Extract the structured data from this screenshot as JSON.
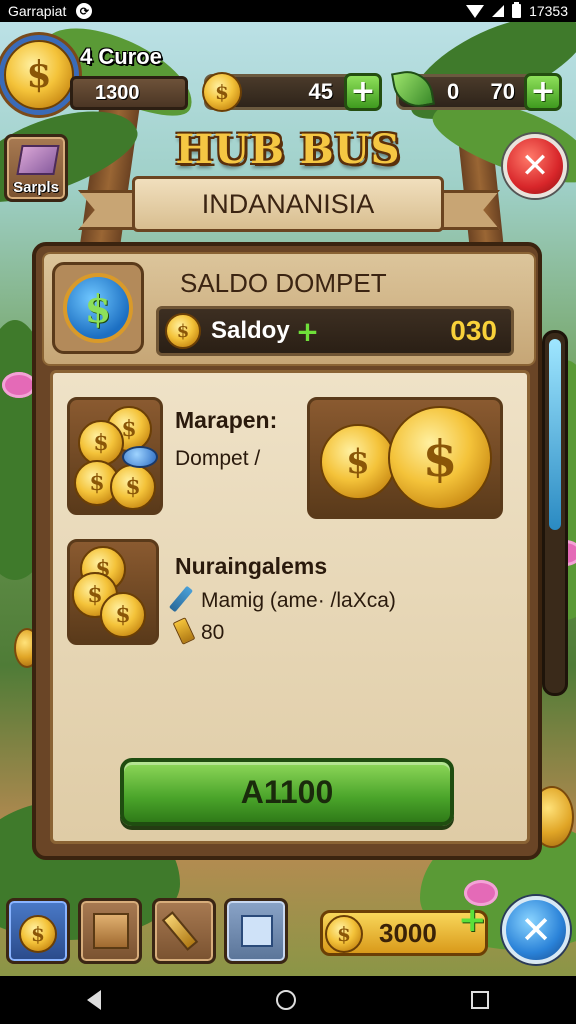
{
  "status_bar": {
    "carrier": "Garrapiat",
    "sync_glyph": "⟳",
    "time": "17353"
  },
  "hud": {
    "profile": {
      "title": "4 Curoe",
      "value": "1300",
      "coin_symbol": "$"
    },
    "coins": {
      "value": "45",
      "coin_symbol": "$",
      "plus": "+"
    },
    "leaves": {
      "value_left": "0",
      "value_right": "70",
      "plus": "+"
    },
    "left_tile": {
      "label": "Sarpls",
      "icon": "gem-icon"
    },
    "close": "✕"
  },
  "title": {
    "main": "HUB BUS",
    "ribbon": "INDANANISIA"
  },
  "panel": {
    "header_title": "SALDO DOMPET",
    "medal_symbol": "$",
    "saldo": {
      "label": "Saldoy",
      "plus": "+",
      "value": "030",
      "coin_symbol": "$"
    },
    "items": [
      {
        "title": "Marapen:",
        "subtitle": "Dompet /",
        "icon": "coin-stack-icon"
      },
      {
        "title": "Nuraingalems",
        "line1": "Mamig (ame· /laXca)",
        "line2": "80",
        "icon": "coin-stack-icon"
      }
    ],
    "scroll_progress": 0.55,
    "primary_button": "A1100"
  },
  "bottom_bar": {
    "tiles": [
      "coin-shop-icon",
      "crate-icon",
      "hammer-icon",
      "map-icon"
    ],
    "gold_value": "3000",
    "coin_symbol": "$",
    "plus": "+",
    "close": "✕"
  },
  "colors": {
    "title_gold": "#f5c743",
    "accent_green": "#4aa42a",
    "close_red": "#d8262a",
    "close_blue": "#2a82d8",
    "saldo_yellow": "#f8d13a"
  }
}
